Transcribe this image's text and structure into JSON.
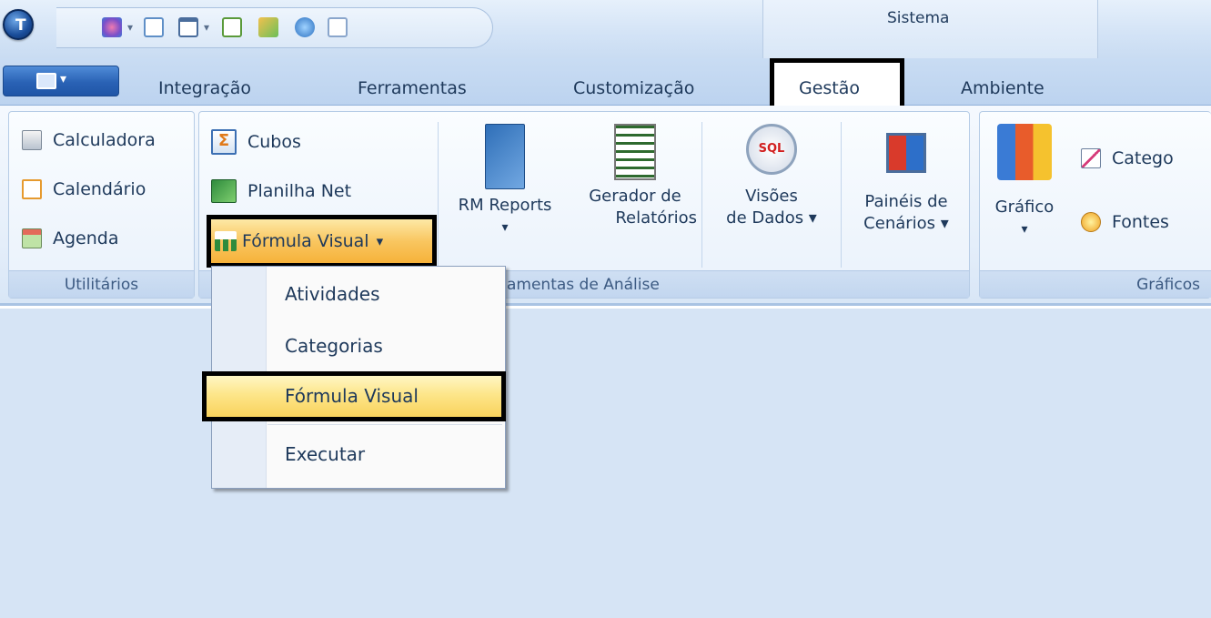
{
  "titlebar": {
    "app_orb_letter": "T",
    "context_title": "Sistema",
    "qat_icons": [
      "refresh-modules-icon",
      "new-document-icon",
      "window-icon",
      "export-icon",
      "tools-icon",
      "globe-icon",
      "copy-icon"
    ]
  },
  "tabs": [
    {
      "label": "Integração"
    },
    {
      "label": "Ferramentas"
    },
    {
      "label": "Customização"
    },
    {
      "label": "Gestão"
    },
    {
      "label": "Ambiente"
    }
  ],
  "ribbon": {
    "utilitarios": {
      "label": "Utilitários",
      "items": [
        "Calculadora",
        "Calendário",
        "Agenda"
      ]
    },
    "analise": {
      "label_visible": "amentas de Análise",
      "small_items": [
        "Cubos",
        "Planilha Net"
      ],
      "formula_visual": "Fórmula Visual",
      "dropdown_arrow": "▾",
      "rm_reports": [
        "RM Reports",
        "▾"
      ],
      "gerador": [
        "Gerador de",
        "Relatórios"
      ],
      "visoes": [
        "Visões",
        "de Dados ▾"
      ],
      "paineis": [
        "Painéis de",
        "Cenários ▾"
      ]
    },
    "graficos": {
      "label": "Gráficos",
      "grafico": [
        "Gráfico",
        "▾"
      ],
      "categorias": "Catego",
      "fontes": "Fontes"
    }
  },
  "menu": {
    "items": [
      "Atividades",
      "Categorias",
      "Fórmula Visual",
      "Executar"
    ]
  },
  "colors": {
    "ribbon_blue": "#bcd3ef",
    "highlight": "#f9c660",
    "workspace": "#d6e4f5"
  }
}
